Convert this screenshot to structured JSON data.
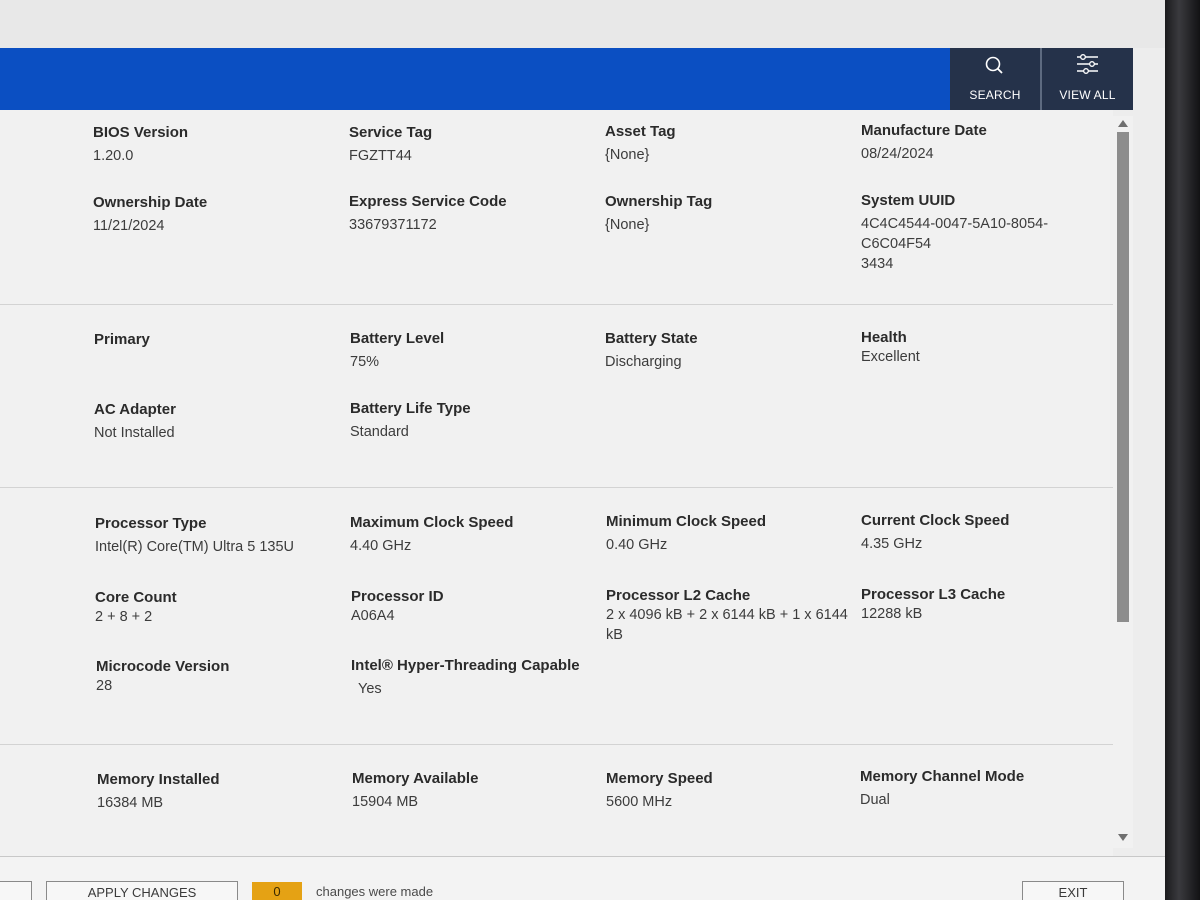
{
  "header": {
    "search_label": "SEARCH",
    "view_all_label": "VIEW ALL"
  },
  "system": {
    "bios_version": {
      "label": "BIOS Version",
      "value": "1.20.0"
    },
    "service_tag": {
      "label": "Service Tag",
      "value": "FGZTT44"
    },
    "asset_tag": {
      "label": "Asset Tag",
      "value": "{None}"
    },
    "manufacture_date": {
      "label": "Manufacture Date",
      "value": "08/24/2024"
    },
    "ownership_date": {
      "label": "Ownership Date",
      "value": "11/21/2024"
    },
    "express_service_code": {
      "label": "Express Service Code",
      "value": "33679371172"
    },
    "ownership_tag": {
      "label": "Ownership Tag",
      "value": "{None}"
    },
    "system_uuid": {
      "label": "System UUID",
      "value_line1": "4C4C4544-0047-5A10-8054-C6C04F54",
      "value_line2": "3434"
    }
  },
  "battery": {
    "primary": {
      "label": "Primary"
    },
    "battery_level": {
      "label": "Battery Level",
      "value": "75%"
    },
    "battery_state": {
      "label": "Battery State",
      "value": "Discharging"
    },
    "health": {
      "label": "Health",
      "value": "Excellent"
    },
    "ac_adapter": {
      "label": "AC Adapter",
      "value": "Not Installed"
    },
    "battery_life_type": {
      "label": "Battery Life Type",
      "value": "Standard"
    }
  },
  "processor": {
    "processor_type": {
      "label": "Processor Type",
      "value": "Intel(R) Core(TM) Ultra 5 135U"
    },
    "max_clock": {
      "label": "Maximum Clock Speed",
      "value": "4.40 GHz"
    },
    "min_clock": {
      "label": "Minimum Clock Speed",
      "value": "0.40 GHz"
    },
    "current_clock": {
      "label": "Current Clock Speed",
      "value": "4.35 GHz"
    },
    "core_count": {
      "label": "Core Count",
      "value": "2 + 8 + 2"
    },
    "processor_id": {
      "label": "Processor ID",
      "value": "A06A4"
    },
    "l2_cache": {
      "label": "Processor L2 Cache",
      "value": "2 x 4096  kB + 2 x 6144  kB + 1 x 6144 kB"
    },
    "l3_cache": {
      "label": "Processor L3 Cache",
      "value": "12288 kB"
    },
    "microcode": {
      "label": "Microcode Version",
      "value": "28"
    },
    "hyper_threading": {
      "label": "Intel® Hyper-Threading Capable",
      "value": "Yes"
    }
  },
  "memory": {
    "installed": {
      "label": "Memory Installed",
      "value": "16384 MB"
    },
    "available": {
      "label": "Memory Available",
      "value": "15904 MB"
    },
    "speed": {
      "label": "Memory Speed",
      "value": "5600 MHz"
    },
    "channel_mode": {
      "label": "Memory Channel Mode",
      "value": "Dual"
    }
  },
  "footer": {
    "apply_label": "APPLY CHANGES",
    "changes_count": "0",
    "changes_text": "changes were made",
    "exit_label": "EXIT"
  }
}
